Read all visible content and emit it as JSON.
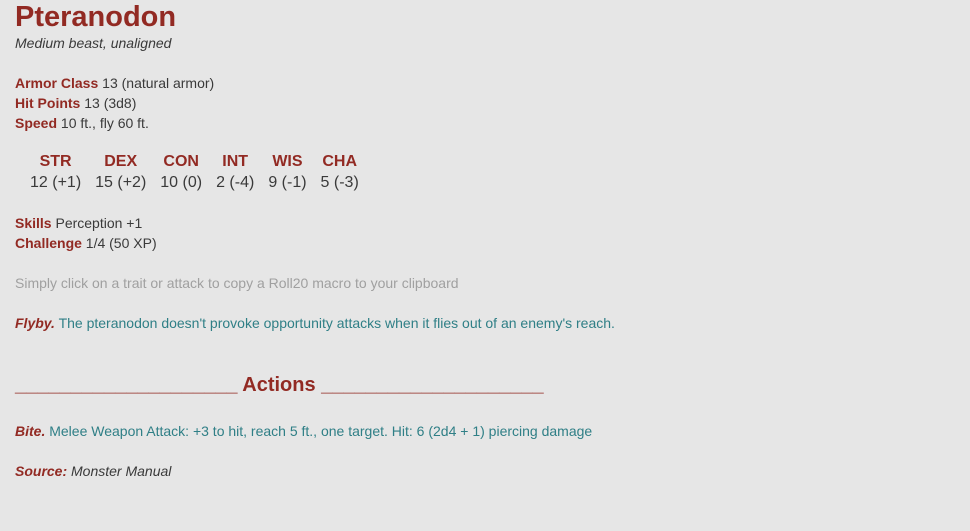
{
  "monster": {
    "name": "Pteranodon",
    "type_line": "Medium beast, unaligned"
  },
  "stats": {
    "armor_class_label": "Armor Class",
    "armor_class_value": "13 (natural armor)",
    "hit_points_label": "Hit Points",
    "hit_points_value": "13 (3d8)",
    "speed_label": "Speed",
    "speed_value": "10 ft., fly 60 ft."
  },
  "abilities": [
    {
      "name": "STR",
      "value": "12 (+1)"
    },
    {
      "name": "DEX",
      "value": "15 (+2)"
    },
    {
      "name": "CON",
      "value": "10 (0)"
    },
    {
      "name": "INT",
      "value": "2 (-4)"
    },
    {
      "name": "WIS",
      "value": "9 (-1)"
    },
    {
      "name": "CHA",
      "value": "5 (-3)"
    }
  ],
  "extra": {
    "skills_label": "Skills",
    "skills_value": "Perception +1",
    "challenge_label": "Challenge",
    "challenge_value": "1/4 (50 XP)"
  },
  "hint": "Simply click on a trait or attack to copy a Roll20 macro to your clipboard",
  "traits": [
    {
      "name": "Flyby.",
      "text": "The pteranodon doesn't provoke opportunity attacks when it flies out of an enemy's reach."
    }
  ],
  "actions_heading": "____________________ Actions ____________________",
  "actions": [
    {
      "name": "Bite.",
      "text": "Melee Weapon Attack: +3 to hit, reach 5 ft., one target. Hit: 6 (2d4 + 1) piercing damage"
    }
  ],
  "source": {
    "label": "Source:",
    "value": "Monster Manual"
  },
  "colors": {
    "background": "#e6e6e6",
    "heading_red": "#922a23",
    "trait_teal": "#2f7f86",
    "hint_gray": "#a0a0a0"
  }
}
